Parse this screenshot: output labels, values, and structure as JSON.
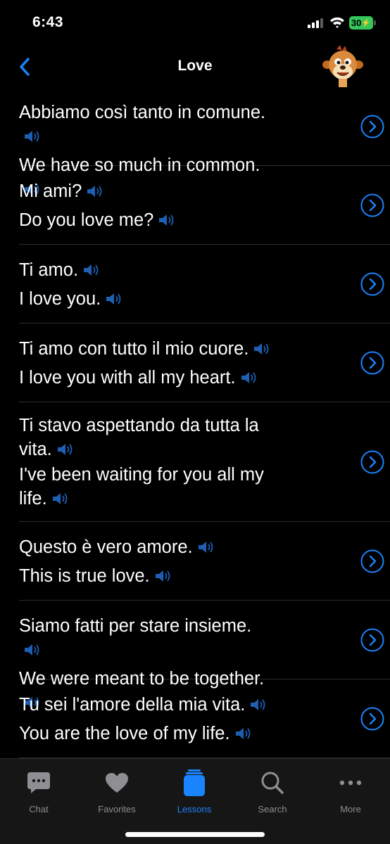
{
  "status": {
    "time": "6:43",
    "battery": "30"
  },
  "nav": {
    "title": "Love"
  },
  "phrases": [
    {
      "it": "Abbiamo così tanto in comune.",
      "en": "We have so much in common."
    },
    {
      "it": "Mi ami?",
      "en": "Do you love me?"
    },
    {
      "it": "Ti amo.",
      "en": "I love you."
    },
    {
      "it": "Ti amo con tutto il mio cuore.",
      "en": "I love you with all my heart."
    },
    {
      "it": "Ti stavo aspettando da tutta la vita.",
      "en": "I've been waiting for you all my life."
    },
    {
      "it": "Questo è vero amore.",
      "en": "This is true love."
    },
    {
      "it": "Siamo fatti per stare insieme.",
      "en": "We were meant to be together."
    },
    {
      "it": "Tu sei l'amore della mia vita.",
      "en": "You are the love of my life."
    }
  ],
  "tabs": [
    {
      "label": "Chat",
      "icon": "chat-icon"
    },
    {
      "label": "Favorites",
      "icon": "heart-icon"
    },
    {
      "label": "Lessons",
      "icon": "lessons-icon"
    },
    {
      "label": "Search",
      "icon": "search-icon"
    },
    {
      "label": "More",
      "icon": "more-icon"
    }
  ],
  "active_tab": "Lessons",
  "colors": {
    "accent": "#1a84ff",
    "speaker": "#1e5fb4",
    "background": "#000000",
    "tab_inactive": "#8e8e93"
  }
}
